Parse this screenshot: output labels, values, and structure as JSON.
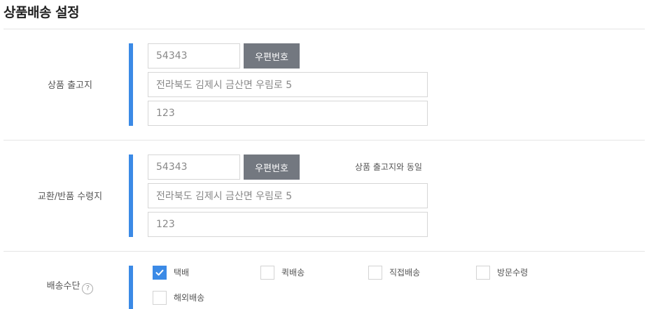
{
  "page_title": "상품배송 설정",
  "origin": {
    "label": "상품 출고지",
    "zipcode": "54343",
    "zip_button": "우편번호",
    "address1": "전라북도 김제시 금산면 우림로 5",
    "address2": "123"
  },
  "return": {
    "label": "교환/반품 수령지",
    "zipcode": "54343",
    "zip_button": "우편번호",
    "same_as_origin": "상품 출고지와 동일",
    "address1": "전라북도 김제시 금산면 우림로 5",
    "address2": "123"
  },
  "delivery": {
    "label": "배송수단",
    "help_icon": "?",
    "options": [
      {
        "label": "택배",
        "checked": true
      },
      {
        "label": "퀵배송",
        "checked": false
      },
      {
        "label": "직접배송",
        "checked": false
      },
      {
        "label": "방문수령",
        "checked": false
      },
      {
        "label": "해외배송",
        "checked": false
      }
    ]
  },
  "colors": {
    "accent": "#3b8ae6",
    "button": "#737880"
  }
}
